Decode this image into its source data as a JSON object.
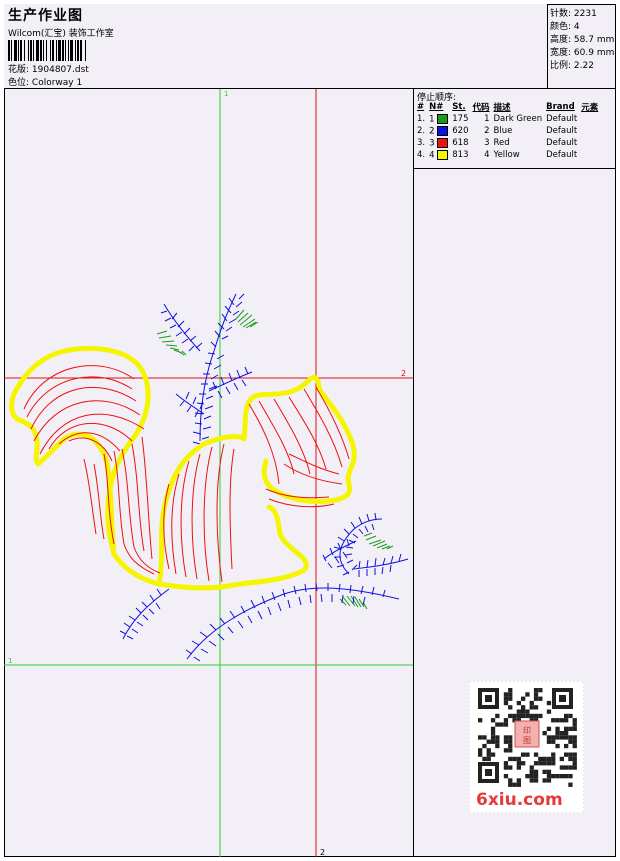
{
  "header": {
    "title": "生产作业图",
    "company": "Wilcom(汇宝) 装饰工作室",
    "design_label": "花版:",
    "design_value": "1904807.dst",
    "colorway_label": "色位:",
    "colorway_value": "Colorway 1"
  },
  "stats": [
    {
      "label": "针数:",
      "value": "2231"
    },
    {
      "label": "颜色:",
      "value": "4"
    },
    {
      "label": "高度:",
      "value": "58.7 mm"
    },
    {
      "label": "宽度:",
      "value": "60.9 mm"
    },
    {
      "label": "比例:",
      "value": "2.22"
    }
  ],
  "stop_sequence": {
    "title": "停止顺序:",
    "columns": [
      "#",
      "N#",
      "St.",
      "代码",
      "描述",
      "Brand",
      "元素"
    ],
    "rows": [
      {
        "idx": "1.",
        "n": "1",
        "color": "#1a9a1a",
        "st": "175",
        "code": "1",
        "desc": "Dark Green",
        "brand": "Default"
      },
      {
        "idx": "2.",
        "n": "2",
        "color": "#1010e0",
        "st": "620",
        "code": "2",
        "desc": "Blue",
        "brand": "Default"
      },
      {
        "idx": "3.",
        "n": "3",
        "color": "#ee1111",
        "st": "618",
        "code": "3",
        "desc": "Red",
        "brand": "Default"
      },
      {
        "idx": "4.",
        "n": "4",
        "color": "#f5f500",
        "st": "813",
        "code": "4",
        "desc": "Yellow",
        "brand": "Default"
      }
    ]
  },
  "guides": {
    "v1_label": "1",
    "v2_label": "2",
    "h1_label": "1",
    "h2_label": "2",
    "v1_color": "#2ecc2e",
    "v2_color": "#e01010",
    "h1_color": "#2ecc2e",
    "h2_color": "#e01010"
  },
  "watermark": {
    "text": "6xiu.com",
    "color": "#e63a3a"
  }
}
